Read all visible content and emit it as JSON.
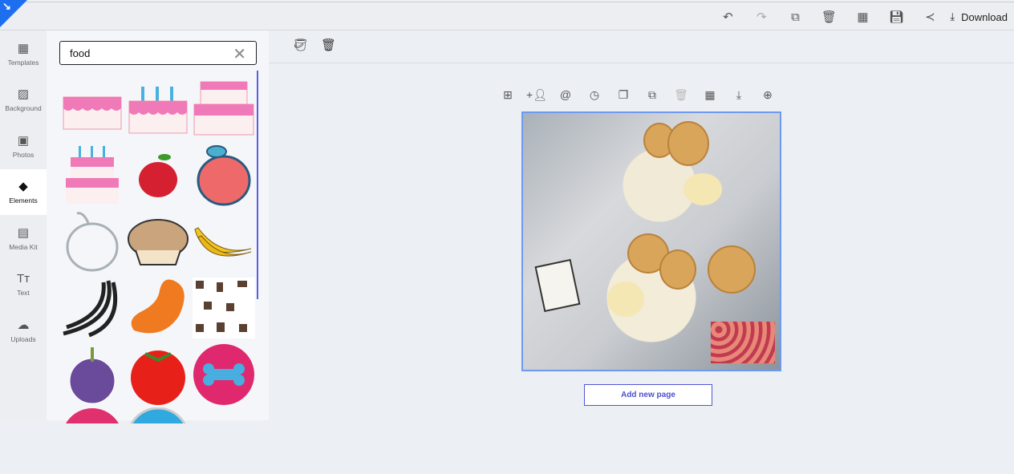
{
  "toolbar": {
    "download_label": "Download",
    "icons": [
      "undo-icon",
      "redo-icon",
      "layers-off-icon",
      "delete-icon",
      "dashboard-icon",
      "save-icon",
      "share-icon",
      "download-icon"
    ]
  },
  "sidebar": {
    "items": [
      {
        "label": "Templates"
      },
      {
        "label": "Background"
      },
      {
        "label": "Photos"
      },
      {
        "label": "Elements"
      },
      {
        "label": "Media Kit"
      },
      {
        "label": "Text"
      },
      {
        "label": "Uploads"
      }
    ],
    "active": "Elements"
  },
  "search": {
    "value": "food"
  },
  "elements": [
    "cake",
    "birthday cake",
    "layer cake",
    "birthday cake",
    "red apple",
    "apple",
    "apple outline",
    "pie",
    "bananas",
    "banana outline",
    "bean",
    "food pattern",
    "onion",
    "tomato",
    "bone badge",
    "badge",
    "badge"
  ],
  "page": {
    "add_page_label": "Add new page"
  }
}
